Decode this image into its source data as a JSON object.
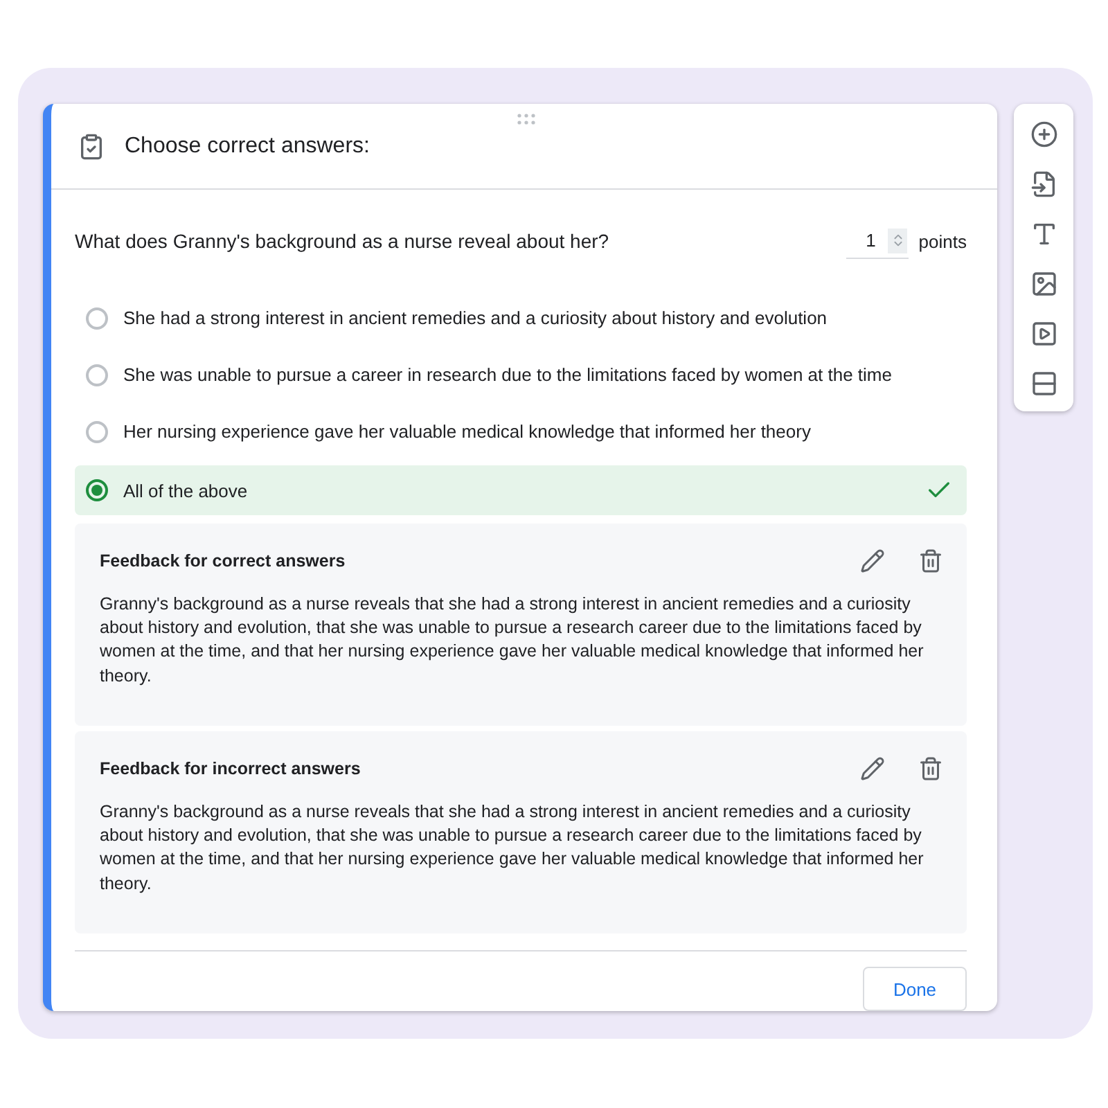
{
  "header": {
    "title": "Choose correct answers:"
  },
  "question": {
    "text": "What does Granny's background as a nurse reveal about her?",
    "points_value": "1",
    "points_label": "points"
  },
  "options": [
    {
      "label": "She had a strong interest in ancient remedies and a curiosity about history and evolution",
      "selected": false
    },
    {
      "label": "She was unable to pursue a career in research due to the limitations faced by women at the time",
      "selected": false
    },
    {
      "label": "Her nursing experience gave her valuable medical knowledge that informed her theory",
      "selected": false
    },
    {
      "label": "All of the above",
      "selected": true
    }
  ],
  "feedback": [
    {
      "title": "Feedback for correct answers",
      "text": "Granny's background as a nurse reveals that she had a strong interest in ancient remedies and a curiosity about history and evolution, that she was unable to pursue a research career due to the limitations faced by women at the time, and that her nursing experience gave her valuable medical knowledge that informed her theory."
    },
    {
      "title": "Feedback for incorrect answers",
      "text": "Granny's background as a nurse reveals that she had a strong interest in ancient remedies and a curiosity about history and evolution, that she was unable to pursue a research career due to the limitations faced by women at the time, and that her nursing experience gave her valuable medical knowledge that informed her theory."
    }
  ],
  "done_button": "Done"
}
